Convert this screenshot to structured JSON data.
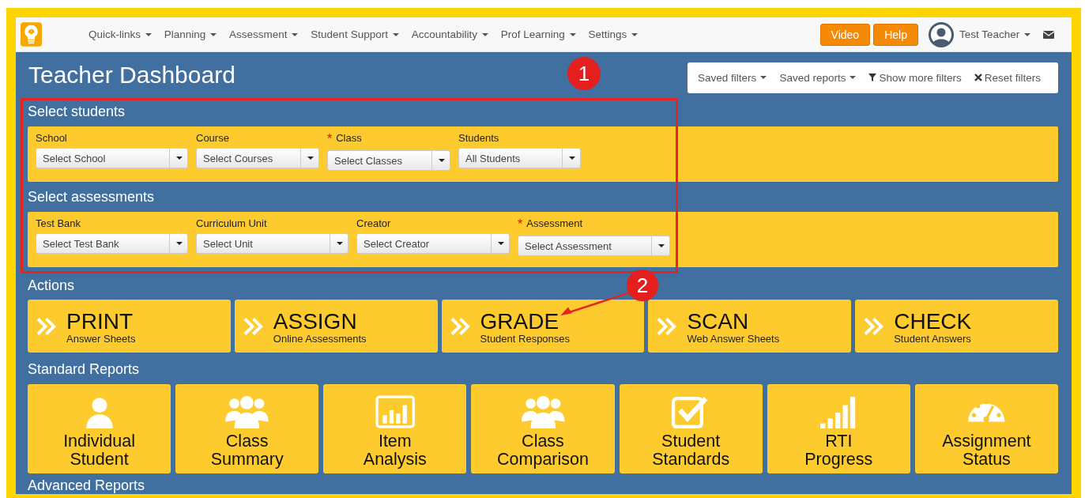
{
  "nav": {
    "menus": [
      {
        "label": "Quick-links"
      },
      {
        "label": "Planning"
      },
      {
        "label": "Assessment"
      },
      {
        "label": "Student Support"
      },
      {
        "label": "Accountability"
      },
      {
        "label": "Prof Learning"
      },
      {
        "label": "Settings"
      }
    ],
    "buttons": [
      "Video",
      "Help"
    ],
    "user": "Test Teacher"
  },
  "page_title": "Teacher Dashboard",
  "filter_bar": [
    {
      "kind": "dropdown",
      "label": "Saved filters"
    },
    {
      "kind": "dropdown",
      "label": "Saved reports"
    },
    {
      "kind": "filter",
      "label": "Show more filters"
    },
    {
      "kind": "reset",
      "label": "Reset filters"
    }
  ],
  "student_filters": {
    "heading": "Select students",
    "fields": [
      {
        "label": "School",
        "value": "Select School"
      },
      {
        "label": "Course",
        "value": "Select Courses"
      },
      {
        "label": "Class",
        "required_mark": "*",
        "value": "Select Classes"
      },
      {
        "label": "Students",
        "value": "All Students"
      }
    ]
  },
  "assessment_filters": {
    "heading": "Select assessments",
    "fields": [
      {
        "label": "Test Bank",
        "value": "Select Test Bank"
      },
      {
        "label": "Curriculum Unit",
        "value": "Select Unit"
      },
      {
        "label": "Creator",
        "value": "Select Creator"
      },
      {
        "label": "Assessment",
        "required_mark": "*",
        "value": "Select Assessment"
      }
    ]
  },
  "actions": {
    "heading": "Actions",
    "tiles": [
      {
        "title": "PRINT",
        "subtitle": "Answer Sheets"
      },
      {
        "title": "ASSIGN",
        "subtitle": "Online Assessments"
      },
      {
        "title": "GRADE",
        "subtitle": "Student Responses"
      },
      {
        "title": "SCAN",
        "subtitle": "Web Answer Sheets"
      },
      {
        "title": "CHECK",
        "subtitle": "Student Answers"
      }
    ]
  },
  "standard_reports": {
    "heading": "Standard Reports",
    "tiles": [
      {
        "kind": "person",
        "lines": [
          "Individual",
          "Student"
        ]
      },
      {
        "kind": "group",
        "lines": [
          "Class",
          "Summary"
        ]
      },
      {
        "kind": "chart",
        "lines": [
          "Item",
          "Analysis"
        ]
      },
      {
        "kind": "group",
        "lines": [
          "Class",
          "Comparison"
        ]
      },
      {
        "kind": "check",
        "lines": [
          "Student",
          "Standards"
        ]
      },
      {
        "kind": "signal",
        "lines": [
          "RTI",
          "Progress"
        ]
      },
      {
        "kind": "gauge",
        "lines": [
          "Assignment",
          "Status"
        ]
      }
    ]
  },
  "advanced_reports_heading": "Advanced Reports",
  "callouts": [
    {
      "label": "1"
    },
    {
      "label": "2"
    }
  ]
}
